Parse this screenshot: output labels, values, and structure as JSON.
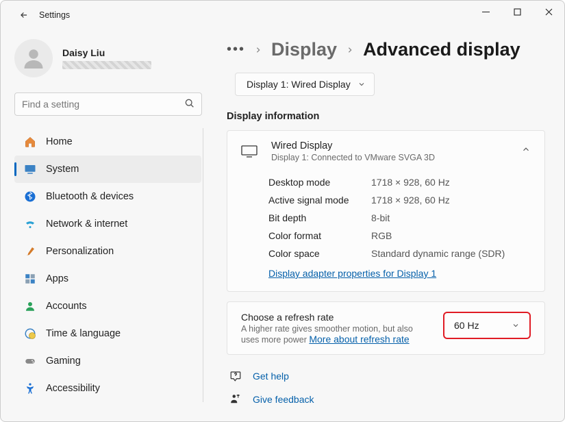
{
  "window": {
    "title": "Settings"
  },
  "profile": {
    "name": "Daisy Liu"
  },
  "search": {
    "placeholder": "Find a setting"
  },
  "nav": [
    {
      "id": "home",
      "label": "Home"
    },
    {
      "id": "system",
      "label": "System"
    },
    {
      "id": "bluetooth",
      "label": "Bluetooth & devices"
    },
    {
      "id": "network",
      "label": "Network & internet"
    },
    {
      "id": "personalization",
      "label": "Personalization"
    },
    {
      "id": "apps",
      "label": "Apps"
    },
    {
      "id": "accounts",
      "label": "Accounts"
    },
    {
      "id": "time",
      "label": "Time & language"
    },
    {
      "id": "gaming",
      "label": "Gaming"
    },
    {
      "id": "accessibility",
      "label": "Accessibility"
    }
  ],
  "breadcrumb": {
    "prev": "Display",
    "current": "Advanced display"
  },
  "display_select": {
    "value": "Display 1: Wired Display"
  },
  "section": {
    "title": "Display information"
  },
  "info": {
    "title": "Wired Display",
    "subtitle": "Display 1: Connected to VMware SVGA 3D",
    "rows": [
      {
        "k": "Desktop mode",
        "v": "1718 × 928, 60 Hz"
      },
      {
        "k": "Active signal mode",
        "v": "1718 × 928, 60 Hz"
      },
      {
        "k": "Bit depth",
        "v": "8-bit"
      },
      {
        "k": "Color format",
        "v": "RGB"
      },
      {
        "k": "Color space",
        "v": "Standard dynamic range (SDR)"
      }
    ],
    "adapter_link": "Display adapter properties for Display 1"
  },
  "refresh": {
    "title": "Choose a refresh rate",
    "subtitle_pre": "A higher rate gives smoother motion, but also uses more power  ",
    "more_link": "More about refresh rate",
    "value": "60 Hz"
  },
  "footer": {
    "get_help": "Get help",
    "give_feedback": "Give feedback"
  }
}
